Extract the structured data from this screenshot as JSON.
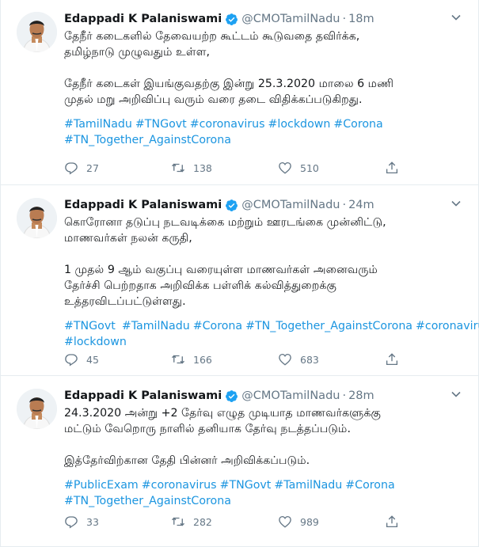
{
  "tweets": [
    {
      "name": "Edappadi K Palaniswami",
      "handle": "@CMOTamilNadu",
      "dot": "·",
      "time": "18m",
      "paragraphs": [
        "தேநீர் கடைகளில் தேவையற்ற கூட்டம் கூடுவதை தவிர்க்க,\nதமிழ்நாடு முழுவதும் உள்ள,",
        "தேநீர் கடைகள் இயங்குவதற்கு இன்று 25.3.2020 மாலை 6 மணி\nமுதல் மறு அறிவிப்பு வரும் வரை தடை விதிக்கப்படுகிறது."
      ],
      "hashtags": [
        "#TamilNadu",
        "#TNGovt",
        "#coronavirus",
        "#lockdown",
        "#Corona",
        "#TN_Together_AgainstCorona"
      ],
      "replies": "27",
      "retweets": "138",
      "likes": "510"
    },
    {
      "name": "Edappadi K Palaniswami",
      "handle": "@CMOTamilNadu",
      "dot": "·",
      "time": "24m",
      "paragraphs": [
        "கொரோனா தடுப்பு நடவடிக்கை மற்றும் ஊரடங்கை முன்னிட்டு,\nமாணவர்கள் நலன் கருதி,",
        "1 முதல் 9 ஆம் வகுப்பு வரையுள்ள மாணவர்கள் அனைவரும்\nதேர்ச்சி பெற்றதாக அறிவிக்க பள்ளிக் கல்வித்துறைக்கு\nஉத்தரவிடப்பட்டுள்ளது."
      ],
      "hashtags": [
        "#TNGovt",
        "#TamilNadu",
        "#Corona",
        "#TN_Together_AgainstCorona",
        "#coronavirus",
        "#lockdown"
      ],
      "replies": "45",
      "retweets": "166",
      "likes": "683"
    },
    {
      "name": "Edappadi K Palaniswami",
      "handle": "@CMOTamilNadu",
      "dot": "·",
      "time": "28m",
      "paragraphs": [
        "24.3.2020 அன்று +2 தேர்வு எழுத முடியாத மாணவர்களுக்கு\nமட்டும் வேறொரு நாளில் தனியாக தேர்வு நடத்தப்படும்.",
        "இத்தேர்விற்கான தேதி பின்னர் அறிவிக்கப்படும்."
      ],
      "hashtags": [
        "#PublicExam",
        "#coronavirus",
        "#TNGovt",
        "#TamilNadu",
        "#Corona",
        "#TN_Together_AgainstCorona"
      ],
      "replies": "33",
      "retweets": "282",
      "likes": "989"
    }
  ],
  "icons": {
    "verified": "verified-badge-icon",
    "caret": "chevron-down-icon",
    "reply": "reply-icon",
    "retweet": "retweet-icon",
    "like": "heart-icon",
    "share": "share-icon"
  },
  "colors": {
    "text": "#14171a",
    "muted": "#657786",
    "link": "#1b95e0",
    "verified": "#1da1f2",
    "divider": "#e6ecf0"
  }
}
